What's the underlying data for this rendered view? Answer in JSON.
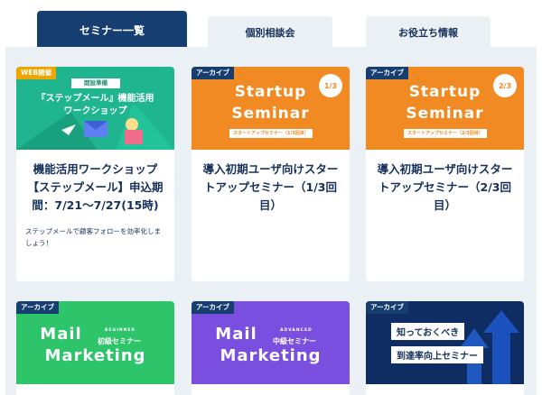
{
  "tabs": [
    {
      "label": "セミナー一覧",
      "active": true
    },
    {
      "label": "個別相談会",
      "active": false
    },
    {
      "label": "お役立ち情報",
      "active": false
    }
  ],
  "cards": [
    {
      "badge": "WEB開催",
      "thumb": {
        "ribbon": "開設準備",
        "line1": "『ステップメール』機能活用",
        "line2": "ワークショップ"
      },
      "title": "機能活用ワークショップ【ステップメール】申込期間：7/21〜7/27(15時)",
      "desc": "ステップメールで顧客フォローを効率化しましょう！"
    },
    {
      "badge": "アーカイブ",
      "thumb": {
        "line1": "Startup",
        "line2": "Seminar",
        "small": "スタートアップセミナー（1/3回目）",
        "fraction": "1/3"
      },
      "title": "導入初期ユーザ向けスタートアップセミナー（1/3回目）",
      "desc": ""
    },
    {
      "badge": "アーカイブ",
      "thumb": {
        "line1": "Startup",
        "line2": "Seminar",
        "small": "スタートアップセミナー（2/3回目）",
        "fraction": "2/3"
      },
      "title": "導入初期ユーザ向けスタートアップセミナー（2/3回目）",
      "desc": ""
    },
    {
      "badge": "アーカイブ",
      "thumb": {
        "line1": "Mail",
        "line2": "Marketing",
        "level_small": "BEGINNER",
        "level": "初級セミナー"
      }
    },
    {
      "badge": "アーカイブ",
      "thumb": {
        "line1": "Mail",
        "line2": "Marketing",
        "level_small": "ADVANCED",
        "level": "中級セミナー"
      }
    },
    {
      "badge": "アーカイブ",
      "thumb": {
        "line1": "知っておくべき",
        "line2": "到達率向上セミナー"
      }
    }
  ],
  "colors": {
    "navy": "#163e70",
    "panel": "#eaf0f4",
    "orange": "#f28a23",
    "green": "#1fb58f",
    "purple": "#7a4fe0",
    "blue_dark": "#0f2d62"
  }
}
